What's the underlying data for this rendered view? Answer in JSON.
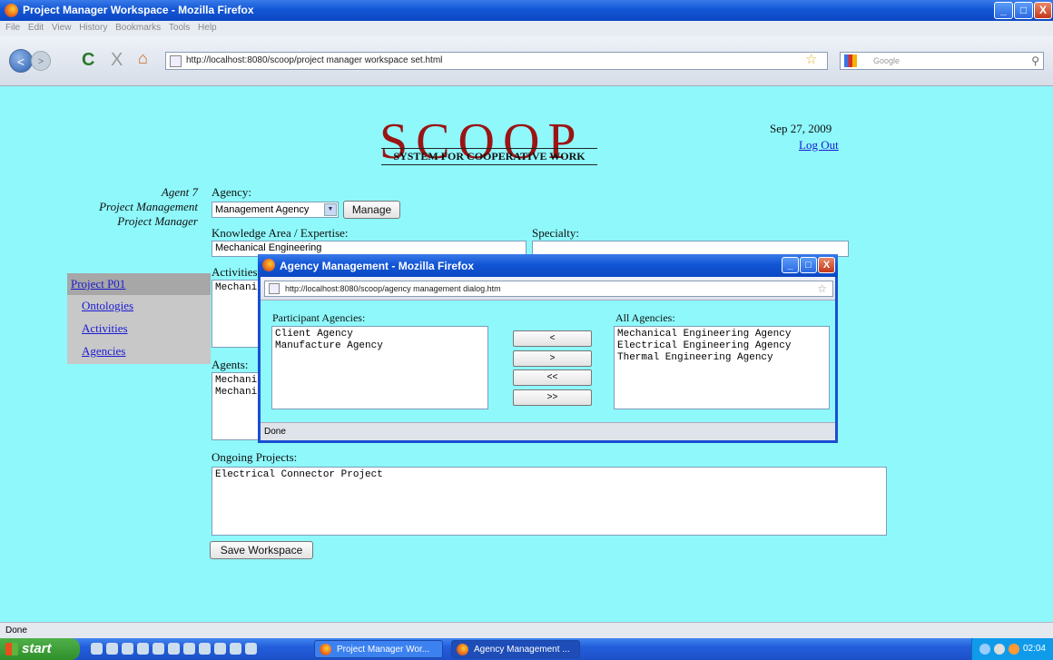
{
  "window": {
    "title": "Project Manager Workspace - Mozilla Firefox",
    "buttons": {
      "minimize": "_",
      "maximize": "□",
      "close": "X"
    }
  },
  "menu": [
    "File",
    "Edit",
    "View",
    "History",
    "Bookmarks",
    "Tools",
    "Help"
  ],
  "nav": {
    "back": "<",
    "forward": ">",
    "reload": "C",
    "stop": "X",
    "home": "⌂",
    "url": "http://localhost:8080/scoop/project manager workspace set.html",
    "bookmark_star": "☆",
    "search_placeholder": "Google",
    "search_icon": "⚲"
  },
  "page": {
    "logo": "SCOOP",
    "tagline": "SYSTEM FOR COOPERATIVE WORK",
    "date": "Sep 27, 2009",
    "logout": "Log Out",
    "agent": {
      "name": "Agent 7",
      "area": "Project Management",
      "role": "Project Manager"
    },
    "sidenav": {
      "project": "Project P01",
      "items": [
        "Ontologies",
        "Activities",
        "Agencies"
      ]
    },
    "agency": {
      "label": "Agency:",
      "selected": "Management Agency",
      "manage_button": "Manage"
    },
    "knowledge": {
      "label": "Knowledge Area / Expertise:",
      "value": "Mechanical Engineering"
    },
    "specialty": {
      "label": "Specialty:",
      "value": ""
    },
    "activities": {
      "label": "Activities",
      "lines": [
        "Mechani"
      ]
    },
    "agents": {
      "label": "Agents:",
      "lines": [
        "Mechani",
        "Mechani"
      ]
    },
    "ongoing": {
      "label": "Ongoing Projects:",
      "lines": [
        "Electrical Connector Project"
      ]
    },
    "save_button": "Save Workspace"
  },
  "dialog": {
    "title": "Agency Management - Mozilla Firefox",
    "buttons": {
      "minimize": "_",
      "maximize": "□",
      "close": "X"
    },
    "url": "http://localhost:8080/scoop/agency management dialog.htm",
    "bookmark_star": "☆",
    "participant_label": "Participant Agencies:",
    "participants": [
      "Client Agency",
      "Manufacture Agency"
    ],
    "all_label": "All Agencies:",
    "all": [
      "Mechanical Engineering Agency",
      "Electrical Engineering Agency",
      "Thermal Engineering Agency"
    ],
    "move_buttons": [
      "<",
      ">",
      "<<",
      ">>"
    ],
    "status": "Done"
  },
  "status": "Done",
  "taskbar": {
    "start": "start",
    "tasks": [
      "Project Manager Wor...",
      "Agency Management ..."
    ],
    "clock": "02:04"
  }
}
